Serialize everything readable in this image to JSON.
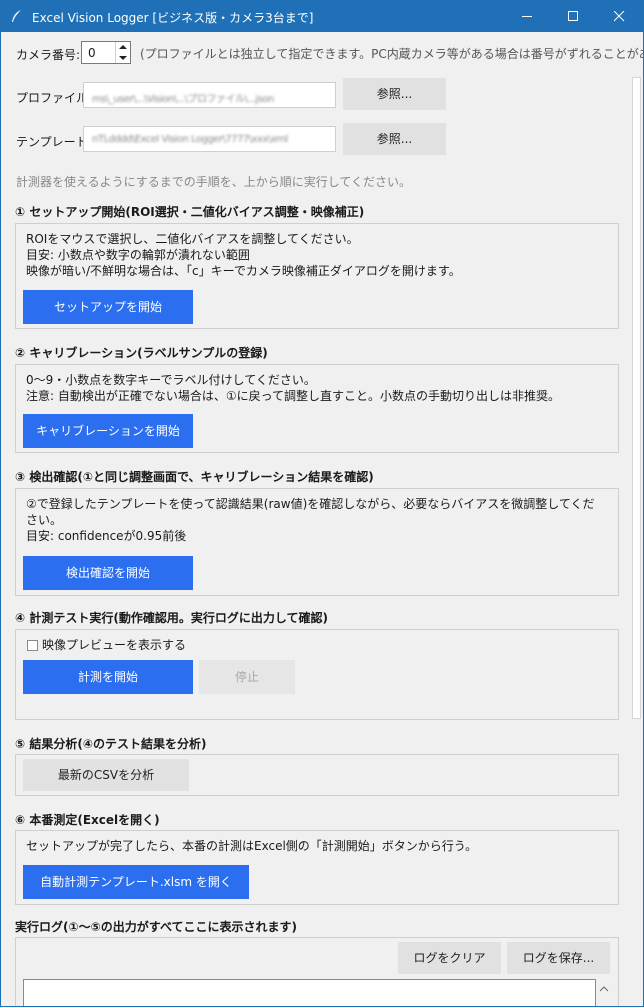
{
  "window": {
    "title": "Excel Vision Logger [ビジネス版・カメラ3台まで]"
  },
  "camera": {
    "label": "カメラ番号:",
    "value": "0",
    "hint": "(プロファイルとは独立して指定できます。PC内蔵カメラ等がある場合は番号がずれることがありま"
  },
  "profile": {
    "label": "プロファイル:",
    "path": "ms\\_user\\...\\Vision\\...\\プロファイル\\...json",
    "browse_label": "参照..."
  },
  "template": {
    "label": "テンプレート:",
    "path": "nTLdddd\\Excel Vision Logger\\7777\\xxx\\xml",
    "browse_label": "参照..."
  },
  "intro_text": "計測器を使えるようにするまでの手順を、上から順に実行してください。",
  "sections": {
    "setup": {
      "title": "① セットアップ開始(ROI選択・二値化バイアス調整・映像補正)",
      "lines": [
        "ROIをマウスで選択し、二値化バイアスを調整してください。",
        "目安: 小数点や数字の輪郭が潰れない範囲",
        "映像が暗い/不鮮明な場合は、「c」キーでカメラ映像補正ダイアログを開けます。"
      ],
      "button": "セットアップを開始"
    },
    "calibration": {
      "title": "② キャリブレーション(ラベルサンプルの登録)",
      "lines": [
        "0〜9・小数点を数字キーでラベル付けしてください。",
        "注意: 自動検出が正確でない場合は、①に戻って調整し直すこと。小数点の手動切り出しは非推奨。"
      ],
      "button": "キャリブレーションを開始"
    },
    "verify": {
      "title": "③ 検出確認(①と同じ調整画面で、キャリブレーション結果を確認)",
      "lines": [
        "②で登録したテンプレートを使って認識結果(raw値)を確認しながら、必要ならバイアスを微調整してくだ",
        "さい。",
        "目安: confidenceが0.95前後"
      ],
      "button": "検出確認を開始"
    },
    "test": {
      "title": "④ 計測テスト実行(動作確認用。実行ログに出力して確認)",
      "preview_label": "映像プレビューを表示する",
      "start_button": "計測を開始",
      "stop_button": "停止"
    },
    "analysis": {
      "title": "⑤ 結果分析(④のテスト結果を分析)",
      "button": "最新のCSVを分析"
    },
    "production": {
      "title": "⑥ 本番測定(Excelを開く)",
      "line": "セットアップが完了したら、本番の計測はExcel側の「計測開始」ボタンから行う。",
      "button": "自動計測テンプレート.xlsm を開く"
    },
    "log": {
      "title": "実行ログ(①〜⑤の出力がすべてここに表示されます)",
      "clear_button": "ログをクリア",
      "save_button": "ログを保存..."
    }
  },
  "colors": {
    "titlebar": "#1f70b6",
    "primary_button": "#2b6ff0",
    "background": "#f0f0f0"
  }
}
